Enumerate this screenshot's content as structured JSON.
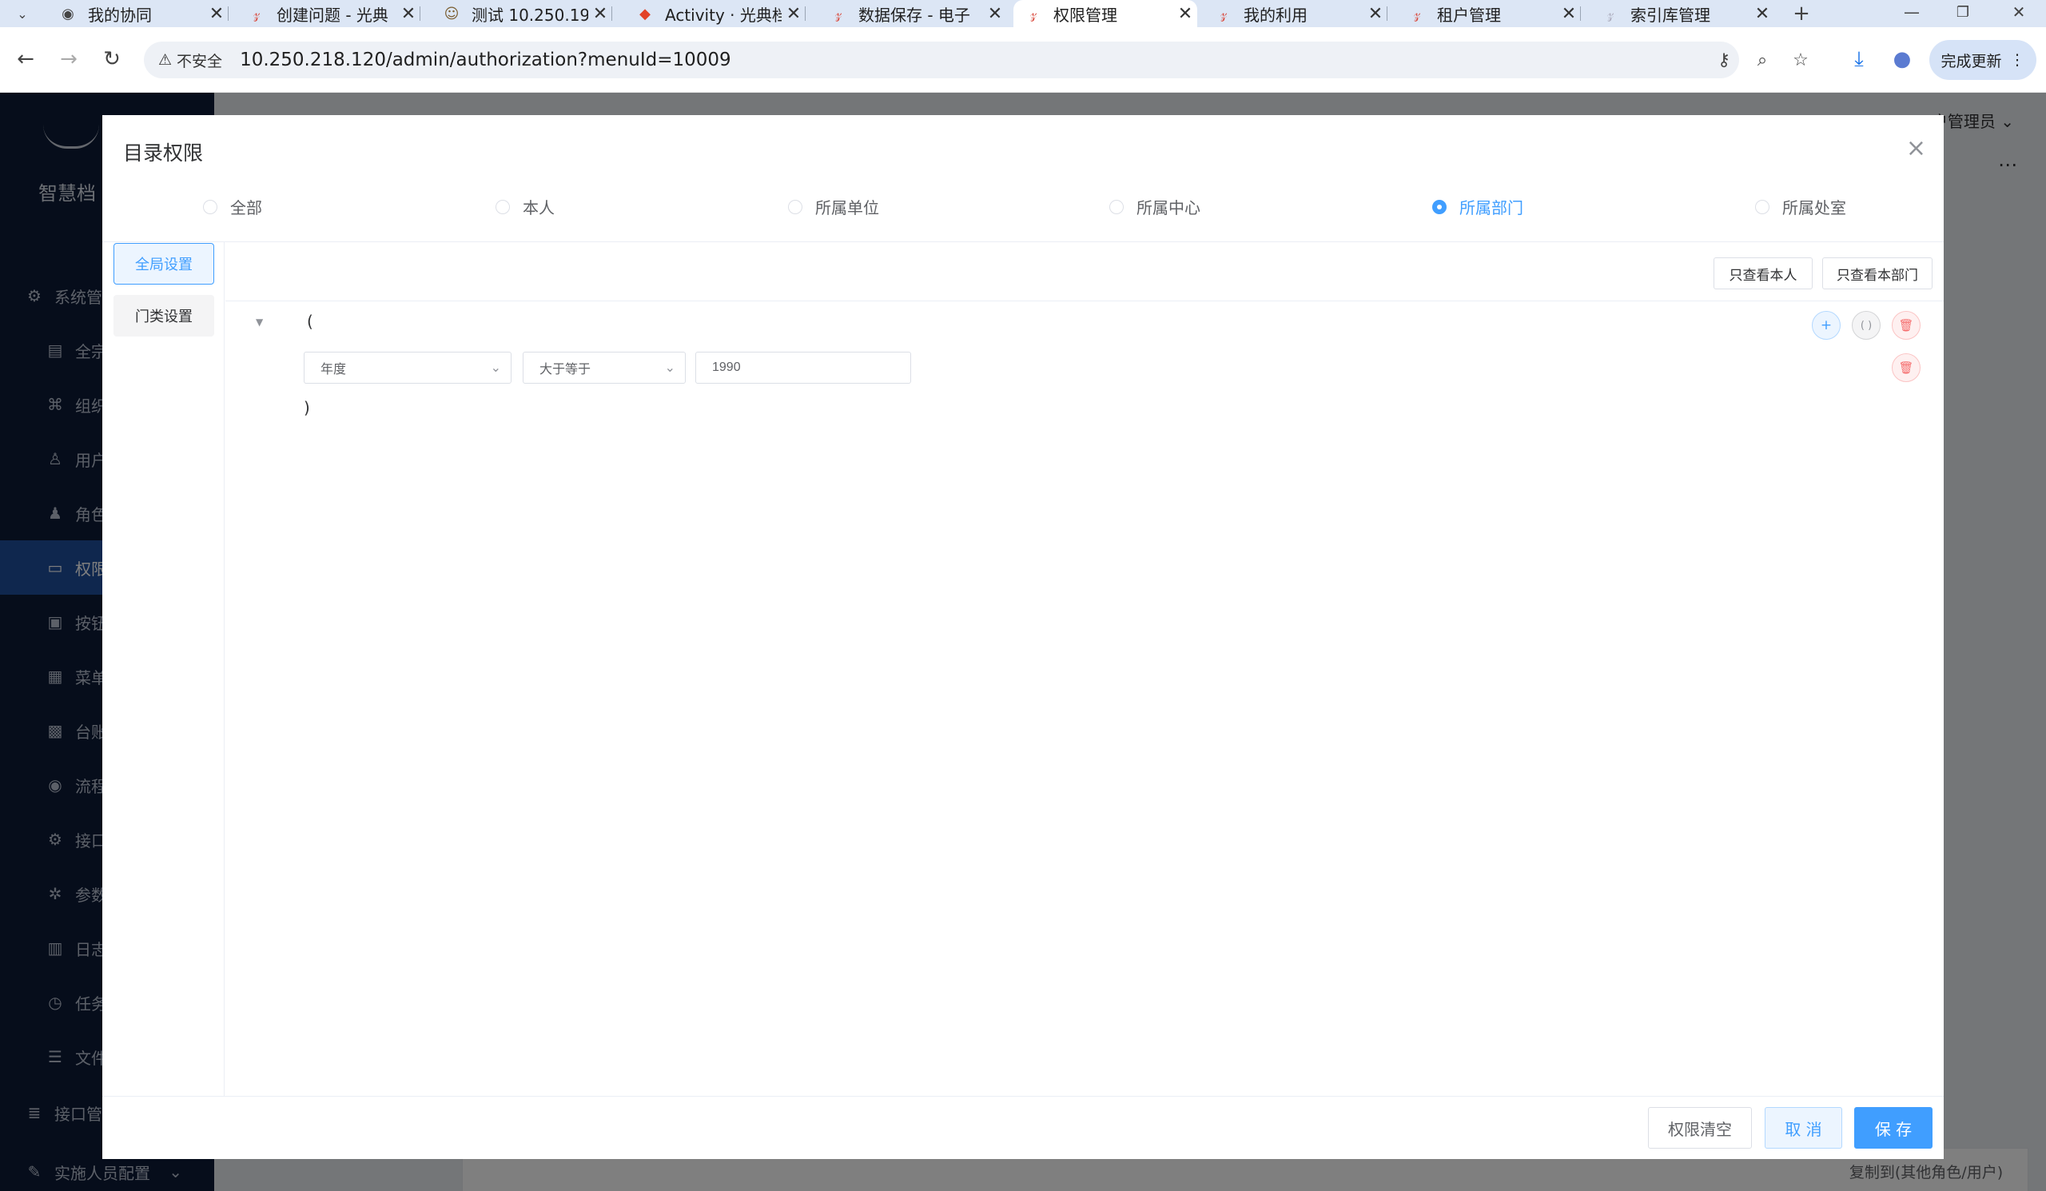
{
  "browser": {
    "tabs": [
      {
        "title": "我的协同",
        "active": false
      },
      {
        "title": "创建问题 - 光典",
        "active": false
      },
      {
        "title": "测试 10.250.19",
        "active": false
      },
      {
        "title": "Activity · 光典档",
        "active": false
      },
      {
        "title": "数据保存 - 电子",
        "active": false
      },
      {
        "title": "权限管理",
        "active": true
      },
      {
        "title": "我的利用",
        "active": false
      },
      {
        "title": "租户管理",
        "active": false
      },
      {
        "title": "索引库管理",
        "active": false
      }
    ],
    "security_label": "不安全",
    "url": "10.250.218.120/admin/authorization?menuId=10009",
    "update_label": "完成更新"
  },
  "sidebar": {
    "brand": "智慧档",
    "items": [
      {
        "label": "系统管",
        "icon": "gear-icon"
      },
      {
        "label": "全宗",
        "icon": "doc-icon"
      },
      {
        "label": "组织",
        "icon": "org-icon"
      },
      {
        "label": "用户",
        "icon": "user-icon"
      },
      {
        "label": "角色",
        "icon": "role-icon"
      },
      {
        "label": "权限",
        "icon": "folder-icon"
      },
      {
        "label": "按钮",
        "icon": "button-icon"
      },
      {
        "label": "菜单",
        "icon": "grid-icon"
      },
      {
        "label": "台账",
        "icon": "apps-icon"
      },
      {
        "label": "流程",
        "icon": "eye-icon"
      },
      {
        "label": "接口",
        "icon": "gear-icon"
      },
      {
        "label": "参数",
        "icon": "cog-icon"
      },
      {
        "label": "日志",
        "icon": "chart-icon"
      },
      {
        "label": "任务",
        "icon": "clock-icon"
      },
      {
        "label": "文件",
        "icon": "sliders-icon"
      },
      {
        "label": "接口管",
        "icon": "database-icon"
      },
      {
        "label": "实施人员配置",
        "icon": "wrench-icon"
      }
    ]
  },
  "header": {
    "user": "户管理员"
  },
  "dialog": {
    "title": "目录权限",
    "scope_options": [
      "全部",
      "本人",
      "所属单位",
      "所属中心",
      "所属部门",
      "所属处室"
    ],
    "selected_scope": "所属部门",
    "left_tabs": [
      "全局设置",
      "门类设置"
    ],
    "active_left_tab": "全局设置",
    "quick_buttons": [
      "只查看本人",
      "只查看本部门"
    ],
    "condition": {
      "open_paren": "(",
      "close_paren": ")",
      "field": "年度",
      "operator": "大于等于",
      "value": "1990",
      "group_label": "( )"
    },
    "footer": {
      "clear": "权限清空",
      "cancel": "取 消",
      "save": "保 存"
    }
  },
  "background": {
    "copy_button": "复制到(其他角色/用户)"
  },
  "colors": {
    "primary": "#409eff",
    "sidebar": "#0d1b36",
    "danger": "#f56c6c"
  }
}
